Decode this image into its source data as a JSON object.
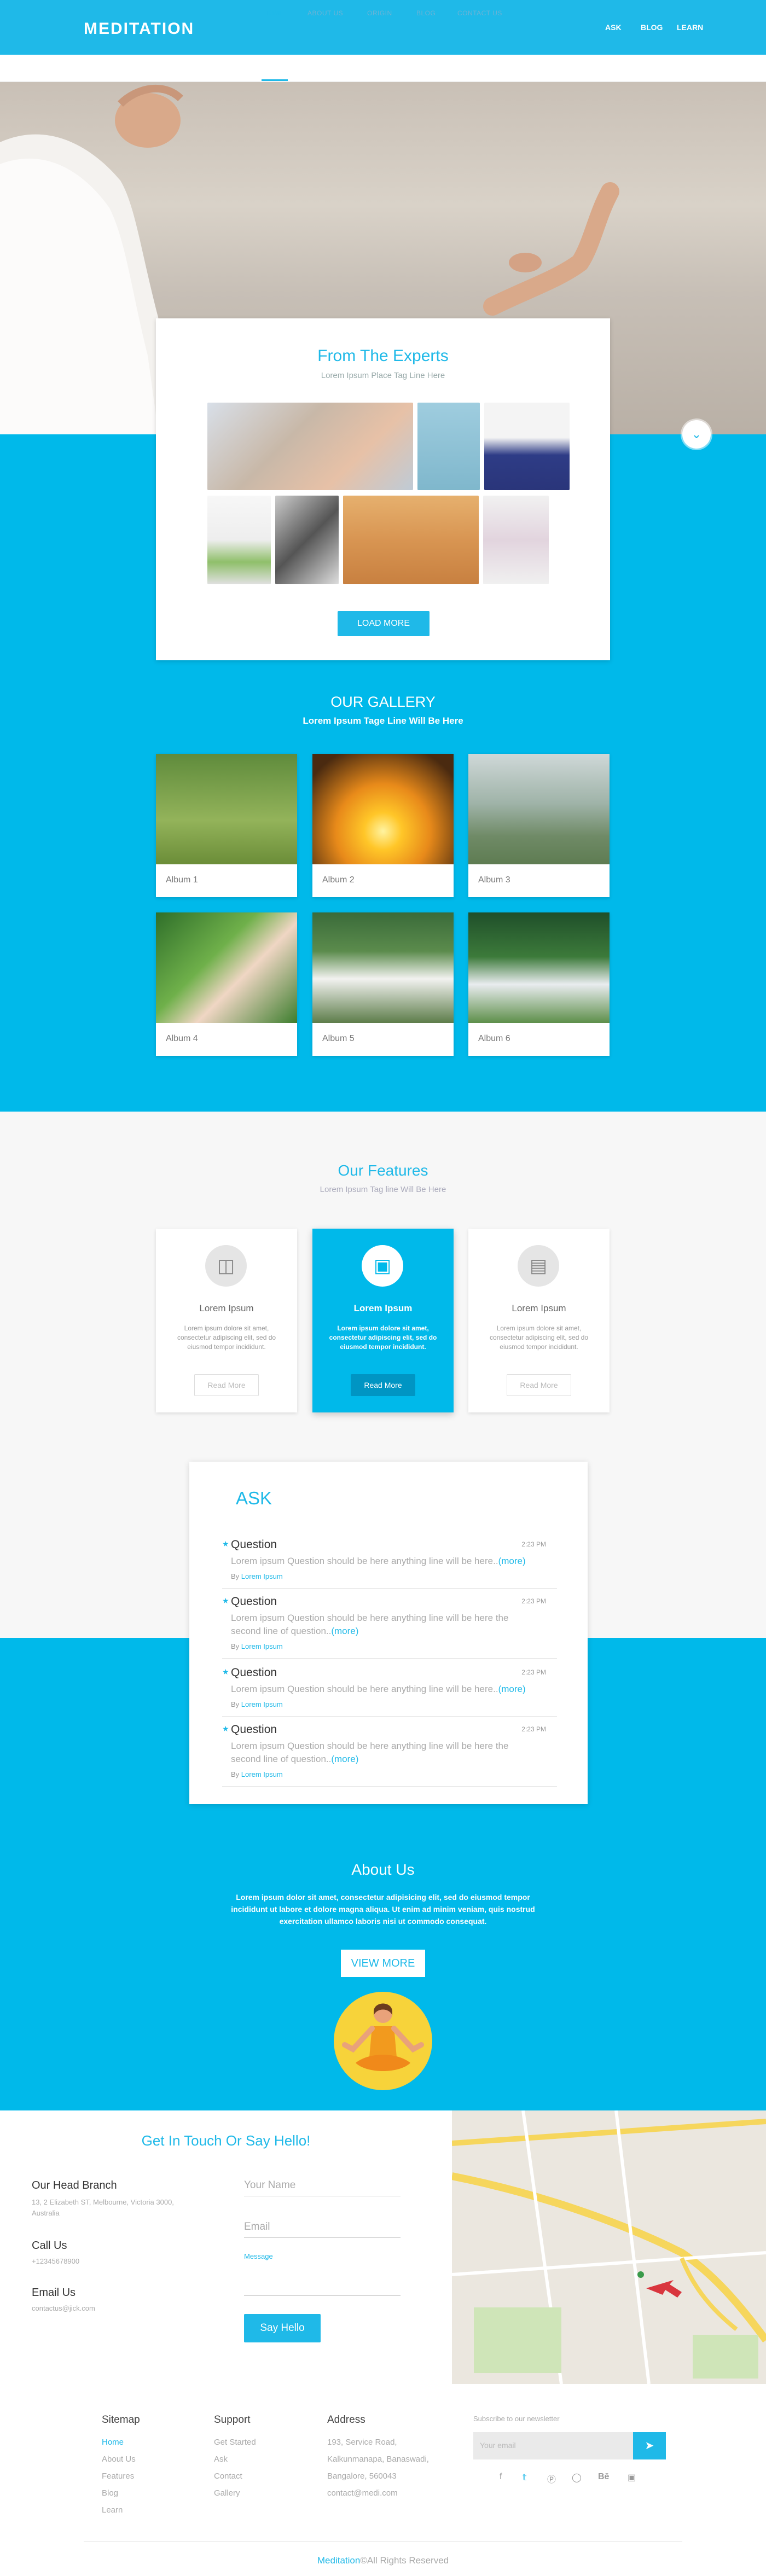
{
  "header": {
    "logo": "MEDITATION",
    "links": [
      "ASK",
      "BLOG",
      "LEARN"
    ]
  },
  "subnav": {
    "items": [
      "HOME",
      "ABOUT US",
      "ORIGIN",
      "BLOG",
      "CONTACT US"
    ],
    "active": "HOME"
  },
  "experts": {
    "title": "From The Experts",
    "tagline": "Lorem Ipsum Place Tag Line Here",
    "load_more": "LOAD MORE"
  },
  "gallery": {
    "title": "OUR GALLERY",
    "tagline": "Lorem Ipsum Tage Line Will Be Here",
    "albums": [
      "Album 1",
      "Album 2",
      "Album 3",
      "Album 4",
      "Album 5",
      "Album 6"
    ]
  },
  "features": {
    "title": "Our Features",
    "tagline": "Lorem Ipsum Tag line Will Be Here",
    "cards": [
      {
        "icon": "globe-icon",
        "title": "Lorem Ipsum",
        "text": "Lorem ipsum dolore sit amet, consectetur adipiscing elit, sed do eiusmod tempor incididunt.",
        "button": "Read More"
      },
      {
        "icon": "car-icon",
        "title": "Lorem Ipsum",
        "text": "Lorem ipsum dolore sit amet, consectetur adipiscing elit, sed do eiusmod tempor incididunt.",
        "button": "Read More"
      },
      {
        "icon": "document-icon",
        "title": "Lorem Ipsum",
        "text": "Lorem ipsum dolore sit amet, consectetur adipiscing elit, sed do eiusmod tempor incididunt.",
        "button": "Read More"
      }
    ]
  },
  "ask": {
    "title": "ASK",
    "questions": [
      {
        "title": "Question",
        "time": "2:23 PM",
        "text": "Lorem ipsum Question should be here anything line will be here..",
        "more": "(more)",
        "by": "By",
        "author": "Lorem Ipsum"
      },
      {
        "title": "Question",
        "time": "2:23 PM",
        "text": "Lorem ipsum Question should be here anything line will be here the second line of question..",
        "more": "(more)",
        "by": "By",
        "author": "Lorem Ipsum"
      },
      {
        "title": "Question",
        "time": "2:23 PM",
        "text": "Lorem ipsum Question should be here anything line will be here..",
        "more": "(more)",
        "by": "By",
        "author": "Lorem Ipsum"
      },
      {
        "title": "Question",
        "time": "2:23 PM",
        "text": "Lorem ipsum Question should be here anything line will be here the second line of question..",
        "more": "(more)",
        "by": "By",
        "author": "Lorem Ipsum"
      }
    ]
  },
  "about": {
    "title": "About Us",
    "text": "Lorem ipsum dolor sit amet, consectetur adipisicing elit, sed do eiusmod tempor incididunt ut labore et dolore magna aliqua. Ut enim ad minim veniam, quis nostrud exercitation ullamco laboris nisi ut commodo consequat.",
    "button": "VIEW MORE"
  },
  "contact": {
    "title": "Get In Touch Or Say Hello!",
    "branch_label": "Our Head Branch",
    "branch_address": "13, 2 Elizabeth ST, Melbourne, Victoria 3000, Australia",
    "call_label": "Call Us",
    "call_value": "+12345678900",
    "email_label": "Email Us",
    "email_value": "contactus@jick.com",
    "name_placeholder": "Your Name",
    "email_placeholder": "Email",
    "message_label": "Message",
    "submit": "Say Hello"
  },
  "footer": {
    "sitemap_title": "Sitemap",
    "sitemap": [
      "Home",
      "About Us",
      "Features",
      "Blog",
      "Learn"
    ],
    "support_title": "Support",
    "support": [
      "Get Started",
      "Ask",
      "Contact",
      "Gallery"
    ],
    "address_title": "Address",
    "address": [
      "193, Service Road,",
      "Kalkunmanapa, Banaswadi,",
      "Bangalore, 560043",
      "contact@medi.com"
    ],
    "newsletter_label": "Subscribe to our newsletter",
    "newsletter_placeholder": "Your email",
    "social": [
      "facebook-icon",
      "twitter-icon",
      "pinterest-icon",
      "dribbble-icon",
      "behance-icon",
      "instagram-icon"
    ],
    "copyright_brand": "Meditation",
    "copyright_rest": "©All Rights Reserved"
  },
  "colors": {
    "accent": "#1fb9e8",
    "section_blue": "#00b9ea"
  }
}
